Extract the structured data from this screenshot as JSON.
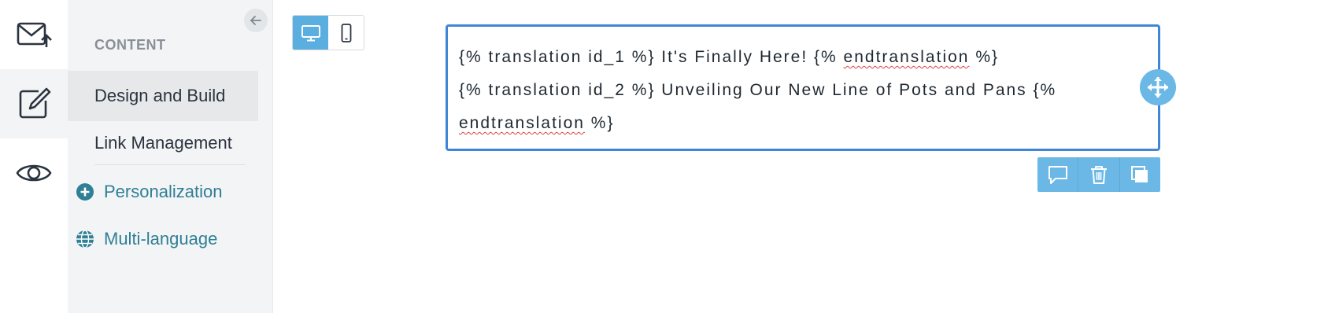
{
  "rail": {
    "items": [
      {
        "name": "email-send",
        "icon": "envelope-upload-icon",
        "active": false
      },
      {
        "name": "design",
        "icon": "edit-icon",
        "active": true
      },
      {
        "name": "preview",
        "icon": "eye-icon",
        "active": false
      }
    ]
  },
  "sidebar": {
    "section_title": "CONTENT",
    "items": [
      {
        "label": "Design and Build",
        "selected": true
      },
      {
        "label": "Link Management",
        "selected": false
      }
    ],
    "extras": [
      {
        "label": "Personalization",
        "icon": "plus-circle-icon"
      },
      {
        "label": "Multi-language",
        "icon": "globe-icon"
      }
    ],
    "collapse_icon": "arrow-left-icon"
  },
  "device_toggle": {
    "options": [
      {
        "icon": "desktop-icon",
        "active": true
      },
      {
        "icon": "mobile-icon",
        "active": false
      }
    ]
  },
  "text_block": {
    "line1_a": "{% translation id_1 %} It's Finally Here! {% ",
    "line1_sq": "endtranslation",
    "line1_b": " %}",
    "line2": "{% translation id_2 %} Unveiling Our New Line of Pots and Pans {%",
    "line3_sq": "endtranslation",
    "line3_b": " %}"
  },
  "block_tools": [
    "comment-icon",
    "trash-icon",
    "duplicate-icon"
  ],
  "colors": {
    "accent": "#5aaee0",
    "selection_border": "#3f87d6",
    "link_teal": "#2f7f95",
    "sidebar_bg": "#f3f4f5"
  }
}
